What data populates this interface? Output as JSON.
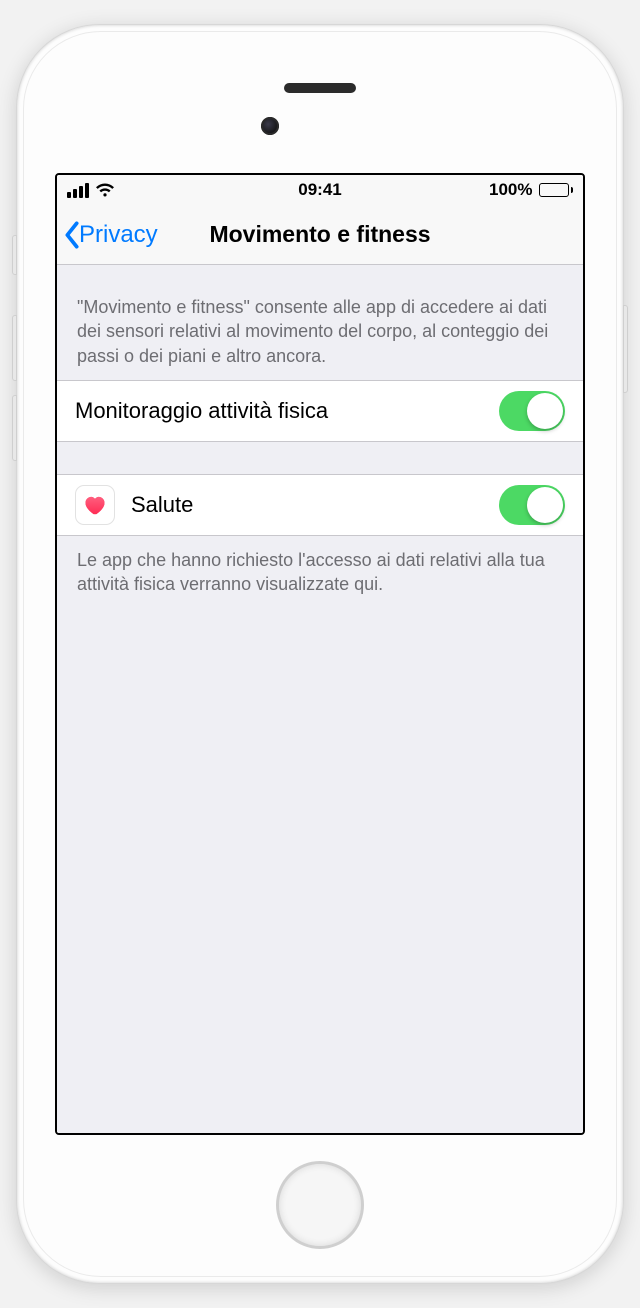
{
  "status": {
    "time": "09:41",
    "battery_pct": "100%"
  },
  "nav": {
    "back_label": "Privacy",
    "title": "Movimento e fitness"
  },
  "descriptions": {
    "header_text": "\"Movimento e fitness\" consente alle app di accedere ai dati dei sensori relativi al movimento del corpo, al conteggio dei passi o dei piani e altro ancora.",
    "footer_text": "Le app che hanno richiesto l'accesso ai dati relativi alla tua attività fisica verranno visualizzate qui."
  },
  "rows": {
    "fitness_tracking": {
      "label": "Monitoraggio attività fisica",
      "on": true
    },
    "health": {
      "label": "Salute",
      "on": true
    }
  }
}
